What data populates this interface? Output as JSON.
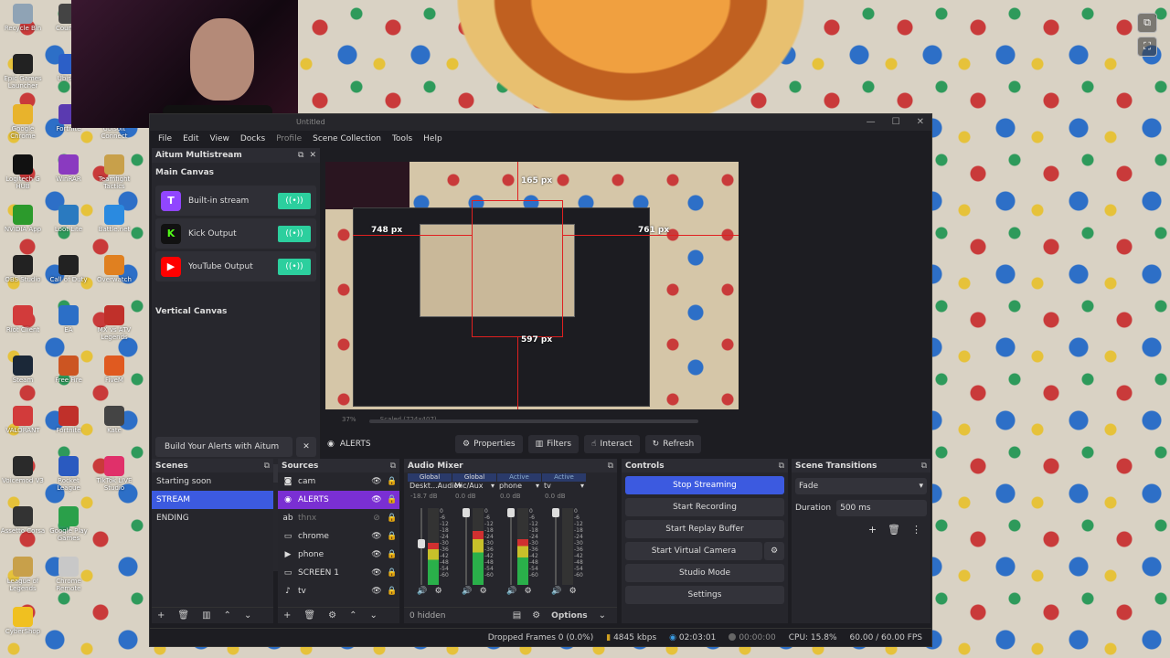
{
  "desktop": {
    "icons": [
      {
        "label": "Recycle Bin",
        "color": "#8fa3b5"
      },
      {
        "label": "Epic Games Launcher",
        "color": "#222222"
      },
      {
        "label": "Google Chrome",
        "color": "#e8b32c"
      },
      {
        "label": "Logitech G HUB",
        "color": "#111111"
      },
      {
        "label": "NVIDIA App",
        "color": "#2c9a2c"
      },
      {
        "label": "OBS Studio",
        "color": "#222222"
      },
      {
        "label": "Riot Client",
        "color": "#d23b3b"
      },
      {
        "label": "Steam",
        "color": "#1b2838"
      },
      {
        "label": "VALORANT",
        "color": "#d23b3b"
      },
      {
        "label": "Voicemod V3",
        "color": "#2a2a2a"
      },
      {
        "label": "Assetto Corsa",
        "color": "#333333"
      },
      {
        "label": "League of Legends",
        "color": "#c8a04a"
      },
      {
        "label": "CyberShop",
        "color": "#f0c020"
      }
    ],
    "icons_col2": [
      {
        "label": "Counter",
        "color": "#444444"
      },
      {
        "label": "Ubisoft",
        "color": "#2c5fc7"
      },
      {
        "label": "Fortnite",
        "color": "#5a3ab0"
      },
      {
        "label": "WinRAR",
        "color": "#8a3ac0"
      },
      {
        "label": "Loot Lite",
        "color": "#2a7ac0"
      },
      {
        "label": "Call of Duty",
        "color": "#222222"
      },
      {
        "label": "EA",
        "color": "#2c6fc7"
      },
      {
        "label": "Free Fire",
        "color": "#cc5522"
      },
      {
        "label": "Fortnite",
        "color": "#c0302a"
      },
      {
        "label": "Rocket League",
        "color": "#2a5ac0"
      },
      {
        "label": "Google Play Games",
        "color": "#2aa04a"
      },
      {
        "label": "Chrome Remote",
        "color": "#c8c8c8"
      }
    ],
    "icons_col3": [
      {
        "label": "HideBar Configure",
        "color": "#666666"
      },
      {
        "label": "Rockstar Games",
        "color": "#e0b020"
      },
      {
        "label": "Ubisoft Connect",
        "color": "#222222"
      },
      {
        "label": "Teamfight Tactics",
        "color": "#c8a04a"
      },
      {
        "label": "Battle.net",
        "color": "#2a8ae0"
      },
      {
        "label": "Overwatch",
        "color": "#e08020"
      },
      {
        "label": "MX vs ATV Legends",
        "color": "#c0302a"
      },
      {
        "label": "FiveM",
        "color": "#e05a20"
      },
      {
        "label": "Kate",
        "color": "#444444"
      },
      {
        "label": "TikTok LIVE Studio",
        "color": "#e0306a"
      }
    ]
  },
  "obs": {
    "title": "Untitled",
    "menu": [
      "File",
      "Edit",
      "View",
      "Docks",
      "Profile",
      "Scene Collection",
      "Tools",
      "Help"
    ],
    "multistream": {
      "title": "Aitum Multistream",
      "main_canvas": "Main Canvas",
      "outputs": [
        {
          "label": "Built-in stream",
          "logo": "T",
          "color": "#9146ff"
        },
        {
          "label": "Kick Output",
          "logo": "K",
          "color": "#111111"
        },
        {
          "label": "YouTube Output",
          "logo": "▶",
          "color": "#ff0000"
        }
      ],
      "vertical_canvas": "Vertical Canvas",
      "build_alerts": "Build Your Alerts with Aitum",
      "toggle_label": "((•))"
    },
    "preview": {
      "labels": [
        "165 px",
        "748 px",
        "761 px",
        "597 px"
      ],
      "zoom": "37%",
      "scaled": "Scaled (724x407)"
    },
    "toolbar": {
      "source_name": "ALERTS",
      "properties": "Properties",
      "filters": "Filters",
      "interact": "Interact",
      "refresh": "Refresh"
    },
    "scenes": {
      "title": "Scenes",
      "items": [
        "Starting soon",
        "STREAM",
        "ENDING"
      ],
      "active_index": 1
    },
    "sources": {
      "title": "Sources",
      "items": [
        {
          "name": "cam",
          "icon": "📷"
        },
        {
          "name": "ALERTS",
          "icon": "◉"
        },
        {
          "name": "thnx",
          "icon": "ab"
        },
        {
          "name": "chrome",
          "icon": "▭"
        },
        {
          "name": "phone",
          "icon": "▶"
        },
        {
          "name": "SCREEN 1",
          "icon": "▭"
        },
        {
          "name": "tv",
          "icon": "🔊"
        }
      ]
    },
    "mixer": {
      "title": "Audio Mixer",
      "channels": [
        {
          "tag": "Global",
          "name": "Deskt...Audio",
          "db": "-18.7 dB",
          "level": 0.55
        },
        {
          "tag": "Global",
          "name": "Mic/Aux",
          "db": "0.0 dB",
          "level": 0.7
        },
        {
          "tag": "Active",
          "name": "phone",
          "db": "0.0 dB",
          "level": 0.6
        },
        {
          "tag": "Active",
          "name": "tv",
          "db": "0.0 dB",
          "level": 0.0
        }
      ],
      "scale": [
        "0",
        "-6",
        "-12",
        "-18",
        "-24",
        "-30",
        "-36",
        "-42",
        "-48",
        "-54",
        "-60"
      ],
      "hidden": "0 hidden",
      "options": "Options"
    },
    "controls": {
      "title": "Controls",
      "buttons": [
        "Stop Streaming",
        "Start Recording",
        "Start Replay Buffer",
        "Start Virtual Camera",
        "Studio Mode",
        "Settings"
      ]
    },
    "transitions": {
      "title": "Scene Transitions",
      "selected": "Fade",
      "duration_label": "Duration",
      "duration_value": "500 ms"
    },
    "status": {
      "dropped": "Dropped Frames 0 (0.0%)",
      "bitrate": "4845 kbps",
      "stream_time": "02:03:01",
      "rec_time": "00:00:00",
      "cpu": "CPU: 15.8%",
      "fps": "60.00 / 60.00 FPS"
    }
  }
}
